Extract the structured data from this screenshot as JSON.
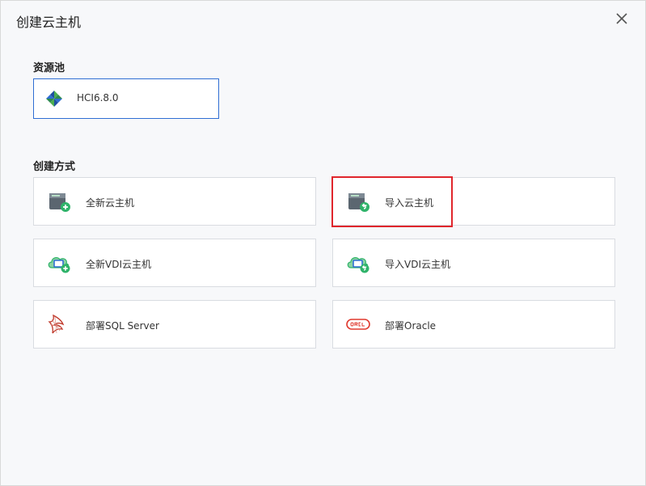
{
  "dialog": {
    "title": "创建云主机",
    "close_icon": "close-icon"
  },
  "resource_pool": {
    "section_title": "资源池",
    "selected": "HCI6.8.0",
    "icon": "hci-logo-icon"
  },
  "create_method": {
    "section_title": "创建方式",
    "options": [
      {
        "label": "全新云主机",
        "icon": "new-vm-icon"
      },
      {
        "label": "导入云主机",
        "icon": "import-vm-icon"
      },
      {
        "label": "全新VDI云主机",
        "icon": "new-vdi-icon"
      },
      {
        "label": "导入VDI云主机",
        "icon": "import-vdi-icon"
      },
      {
        "label": "部署SQL Server",
        "icon": "sql-server-icon"
      },
      {
        "label": "部署Oracle",
        "icon": "oracle-icon"
      }
    ]
  },
  "colors": {
    "selected_border": "#2f6ed3",
    "highlight": "#e0262c",
    "green_badge": "#2fb36a"
  }
}
